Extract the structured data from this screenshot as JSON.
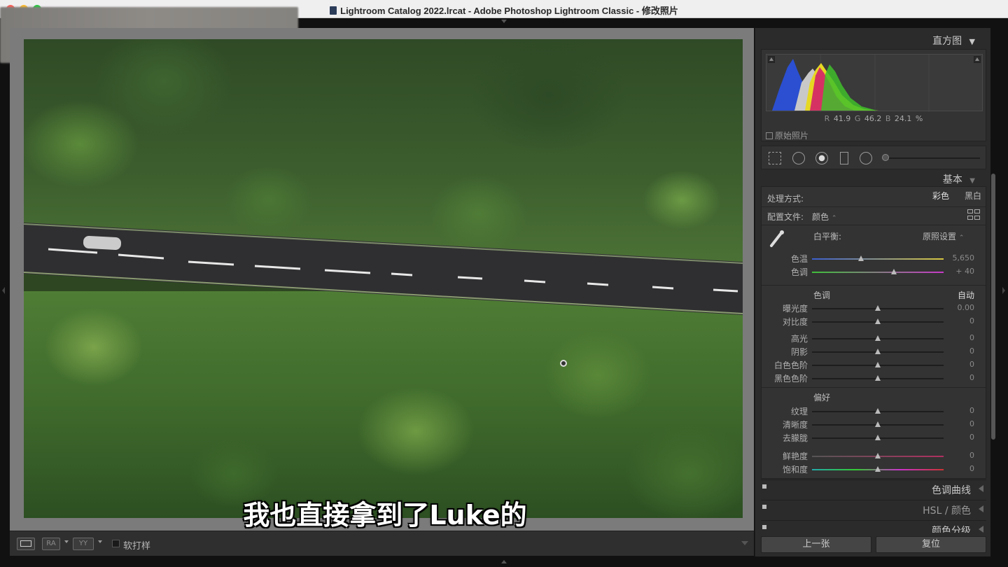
{
  "window": {
    "title": "Lightroom Catalog 2022.lrcat - Adobe Photoshop Lightroom Classic - 修改照片"
  },
  "subtitle": "我也直接拿到了Luke的",
  "toolbar": {
    "view_ra": "RA",
    "view_yy": "YY",
    "soft_proof": "软打样"
  },
  "histogram": {
    "title": "直方图",
    "r_label": "R",
    "r_value": "41.9",
    "g_label": "G",
    "g_value": "46.2",
    "b_label": "B",
    "b_value": "24.1 %",
    "original_photo": "原始照片"
  },
  "basic": {
    "title": "基本",
    "treatment_label": "处理方式:",
    "color": "彩色",
    "bw": "黑白",
    "profile_label": "配置文件:",
    "profile_value": "颜色",
    "wb_label": "白平衡:",
    "wb_value": "原照设置",
    "wb_sliders": [
      {
        "label": "色温",
        "value": "5,650",
        "pos": 0.37
      },
      {
        "label": "色调",
        "value": "+ 40",
        "pos": 0.62
      }
    ],
    "tone_label": "色调",
    "auto": "自动",
    "tone_sliders": [
      {
        "label": "曝光度",
        "value": "0.00",
        "pos": 0.5
      },
      {
        "label": "对比度",
        "value": "0",
        "pos": 0.5
      },
      {
        "label": "高光",
        "value": "0",
        "pos": 0.5
      },
      {
        "label": "阴影",
        "value": "0",
        "pos": 0.5
      },
      {
        "label": "白色色阶",
        "value": "0",
        "pos": 0.5
      },
      {
        "label": "黑色色阶",
        "value": "0",
        "pos": 0.5
      }
    ],
    "presence_label": "偏好",
    "presence_sliders": [
      {
        "label": "纹理",
        "value": "0",
        "pos": 0.5
      },
      {
        "label": "清晰度",
        "value": "0",
        "pos": 0.5
      },
      {
        "label": "去朦胧",
        "value": "0",
        "pos": 0.5
      },
      {
        "label": "鲜艳度",
        "value": "0",
        "pos": 0.5
      },
      {
        "label": "饱和度",
        "value": "0",
        "pos": 0.5
      }
    ]
  },
  "panels": [
    {
      "label": "色调曲线"
    },
    {
      "label": "HSL / 颜色"
    },
    {
      "label": "颜色分级"
    }
  ],
  "buttons": {
    "previous": "上一张",
    "reset": "复位"
  }
}
